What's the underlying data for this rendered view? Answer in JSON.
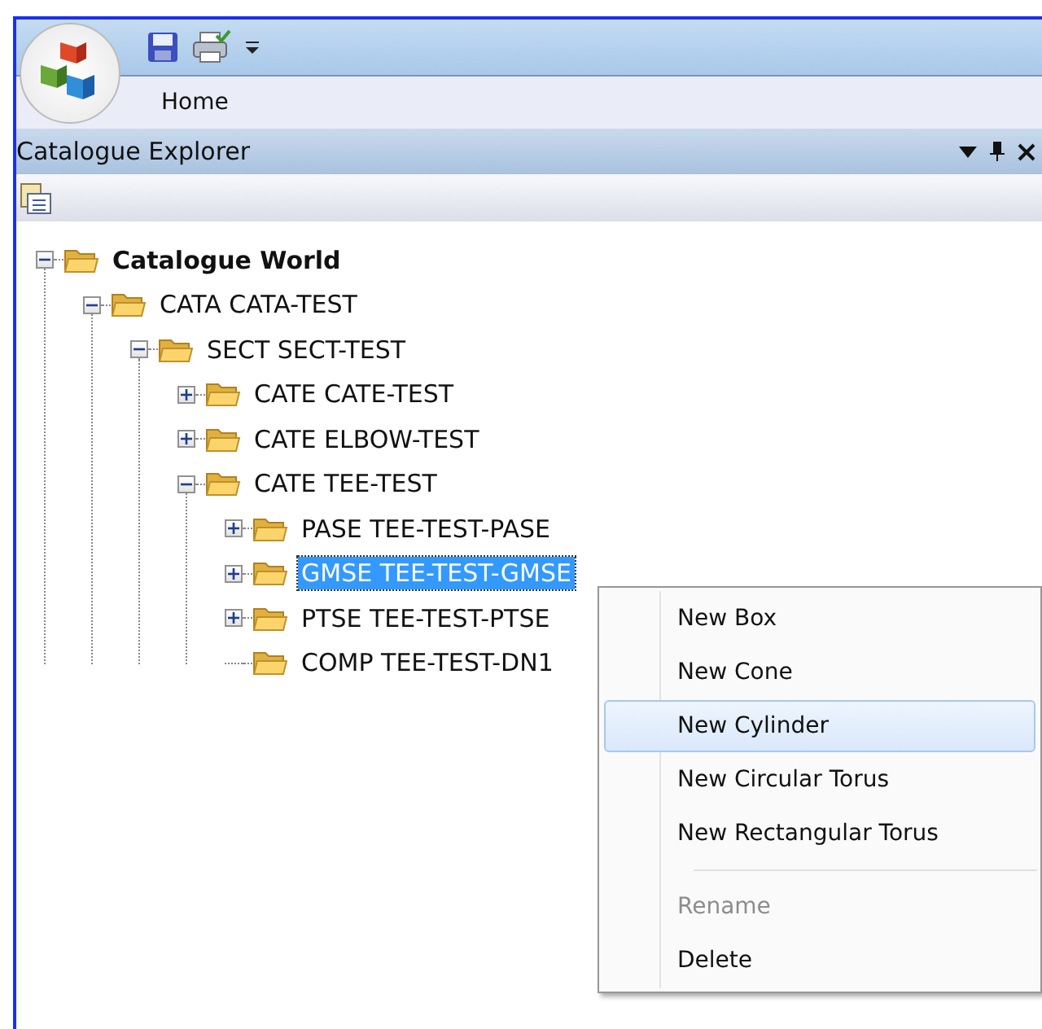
{
  "ribbon": {
    "tabs": [
      {
        "label": "Home",
        "selected": true
      }
    ]
  },
  "panel": {
    "title": "Catalogue Explorer"
  },
  "tree": [
    {
      "label": "Catalogue World",
      "bold": true,
      "expanded": true,
      "selected": false,
      "children": [
        {
          "label": "CATA CATA-TEST",
          "expanded": true,
          "selected": false,
          "children": [
            {
              "label": "SECT SECT-TEST",
              "expanded": true,
              "selected": false,
              "children": [
                {
                  "label": "CATE CATE-TEST",
                  "expanded": false,
                  "selected": false
                },
                {
                  "label": "CATE ELBOW-TEST",
                  "expanded": false,
                  "selected": false
                },
                {
                  "label": "CATE TEE-TEST",
                  "expanded": true,
                  "selected": false,
                  "children": [
                    {
                      "label": "PASE TEE-TEST-PASE",
                      "expanded": false,
                      "selected": false
                    },
                    {
                      "label": "GMSE TEE-TEST-GMSE",
                      "expanded": false,
                      "selected": true
                    },
                    {
                      "label": "PTSE TEE-TEST-PTSE",
                      "expanded": false,
                      "selected": false
                    },
                    {
                      "label": "COMP TEE-TEST-DN1",
                      "selected": false
                    }
                  ]
                }
              ]
            }
          ]
        }
      ]
    }
  ],
  "context_menu": [
    {
      "kind": "item",
      "label": "New Box",
      "selected": false,
      "disabled": false
    },
    {
      "kind": "item",
      "label": "New Cone",
      "selected": false,
      "disabled": false
    },
    {
      "kind": "item",
      "label": "New Cylinder",
      "selected": true,
      "disabled": false
    },
    {
      "kind": "item",
      "label": "New Circular Torus",
      "selected": false,
      "disabled": false
    },
    {
      "kind": "item",
      "label": "New Rectangular Torus",
      "selected": false,
      "disabled": false
    },
    {
      "kind": "separator"
    },
    {
      "kind": "item",
      "label": "Rename",
      "selected": false,
      "disabled": true
    },
    {
      "kind": "item",
      "label": "Delete",
      "selected": false,
      "disabled": false
    }
  ]
}
